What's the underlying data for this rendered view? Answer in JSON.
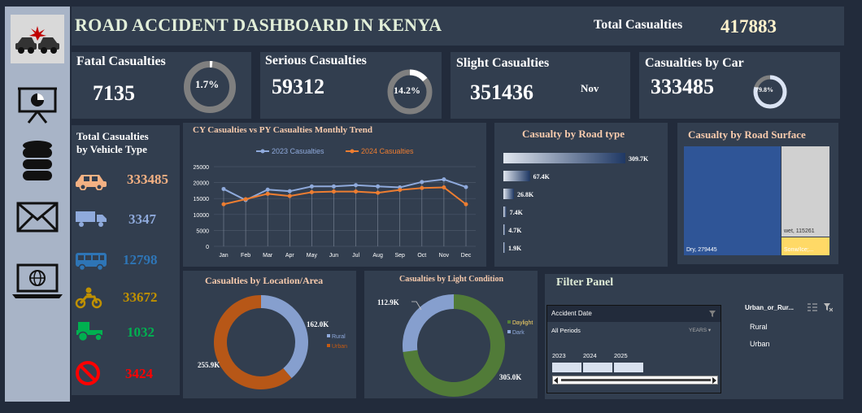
{
  "header": {
    "title": "ROAD ACCIDENT DASHBOARD IN KENYA",
    "total_label": "Total Casualties",
    "total_value": "417883"
  },
  "sidebar": {
    "icons": [
      "car-crash-icon",
      "presentation-icon",
      "database-icon",
      "mail-icon",
      "laptop-globe-icon"
    ]
  },
  "kpis": {
    "fatal": {
      "label": "Fatal Casualties",
      "value": "7135",
      "pct": "1.7%",
      "fraction": 0.017
    },
    "serious": {
      "label": "Serious Casualties",
      "value": "59312",
      "pct": "14.2%",
      "fraction": 0.142
    },
    "slight": {
      "label": "Slight Casualties",
      "value": "351436",
      "extra": "Nov"
    },
    "car": {
      "label": "Casualties by Car",
      "value": "333485",
      "pct": "79.8%",
      "fraction": 0.798
    }
  },
  "vehicle": {
    "title_line1": "Total Casualties",
    "title_line2": "by Vehicle Type",
    "items": [
      {
        "icon": "car-icon",
        "value": "333485",
        "color": "#f4b183"
      },
      {
        "icon": "truck-icon",
        "value": "3347",
        "color": "#8faadc"
      },
      {
        "icon": "bus-icon",
        "value": "12798",
        "color": "#2e75b6"
      },
      {
        "icon": "motorcycle-icon",
        "value": "33672",
        "color": "#bf9000"
      },
      {
        "icon": "tractor-icon",
        "value": "1032",
        "color": "#00b050"
      },
      {
        "icon": "no-entry-icon",
        "value": "3424",
        "color": "#ff0000"
      }
    ]
  },
  "trend_title": "CY Casualties vs PY Casualties Monthly Trend",
  "road_type_title": "Casualty by Road type",
  "road_surface_title": "Casualty by Road Surface",
  "location_title": "Casualties by Location/Area",
  "light_title": "Casualties by Light Condition",
  "filter": {
    "title": "Filter Panel",
    "date_header": "Accident  Date",
    "all_periods": "All Periods",
    "years_label": "YEARS",
    "years": [
      "2023",
      "2024",
      "2025"
    ],
    "area_header": "Urban_or_Rur...",
    "area_options": [
      "Rural",
      "Urban"
    ]
  },
  "chart_data": [
    {
      "type": "line",
      "title": "CY Casualties vs PY Casualties Monthly Trend",
      "categories": [
        "Jan",
        "Feb",
        "Mar",
        "Apr",
        "May",
        "Jun",
        "Jul",
        "Aug",
        "Sep",
        "Oct",
        "Nov",
        "Dec"
      ],
      "series": [
        {
          "name": "2023 Casualties",
          "color": "#8faadc",
          "values": [
            18000,
            14500,
            17800,
            17300,
            18800,
            18800,
            19200,
            18800,
            18500,
            20200,
            21000,
            18600
          ]
        },
        {
          "name": "2024 Casualties",
          "color": "#ed7d31",
          "values": [
            13200,
            14800,
            16500,
            15800,
            17000,
            17200,
            17200,
            16800,
            17700,
            18300,
            18500,
            13200
          ]
        }
      ],
      "yticks": [
        0,
        5000,
        10000,
        15000,
        20000,
        25000
      ],
      "ylim": [
        0,
        25000
      ],
      "legend": "top",
      "grid": true
    },
    {
      "type": "bar",
      "title": "Casualty by Road type",
      "orientation": "horizontal",
      "values": [
        309.7,
        67.4,
        26.8,
        7.4,
        4.7,
        1.9
      ],
      "labels": [
        "309.7K",
        "67.4K",
        "26.8K",
        "7.4K",
        "4.7K",
        "1.9K"
      ]
    },
    {
      "type": "heatmap",
      "title": "Casualty by Road Surface",
      "cells": [
        {
          "label": "Dry, 279445",
          "value": 279445,
          "color": "#2f5597"
        },
        {
          "label": "wet, 115261",
          "value": 115261,
          "color": "#d0d0d0"
        },
        {
          "label": "Sonw/Ice;...",
          "value": 23177,
          "color": "#ffd966"
        }
      ]
    },
    {
      "type": "pie",
      "title": "Casualties by Location/Area",
      "slices": [
        {
          "name": "Rural",
          "value": 162.0,
          "label": "162.0K",
          "color": "#8faadc"
        },
        {
          "name": "Urban",
          "value": 255.9,
          "label": "255.9K",
          "color": "#c55a11"
        }
      ]
    },
    {
      "type": "pie",
      "title": "Casualties by Light Condition",
      "slices": [
        {
          "name": "Daylight",
          "value": 305.0,
          "label": "305.0K",
          "color": "#548235"
        },
        {
          "name": "Dark",
          "value": 112.9,
          "label": "112.9K",
          "color": "#8faadc"
        }
      ]
    }
  ]
}
